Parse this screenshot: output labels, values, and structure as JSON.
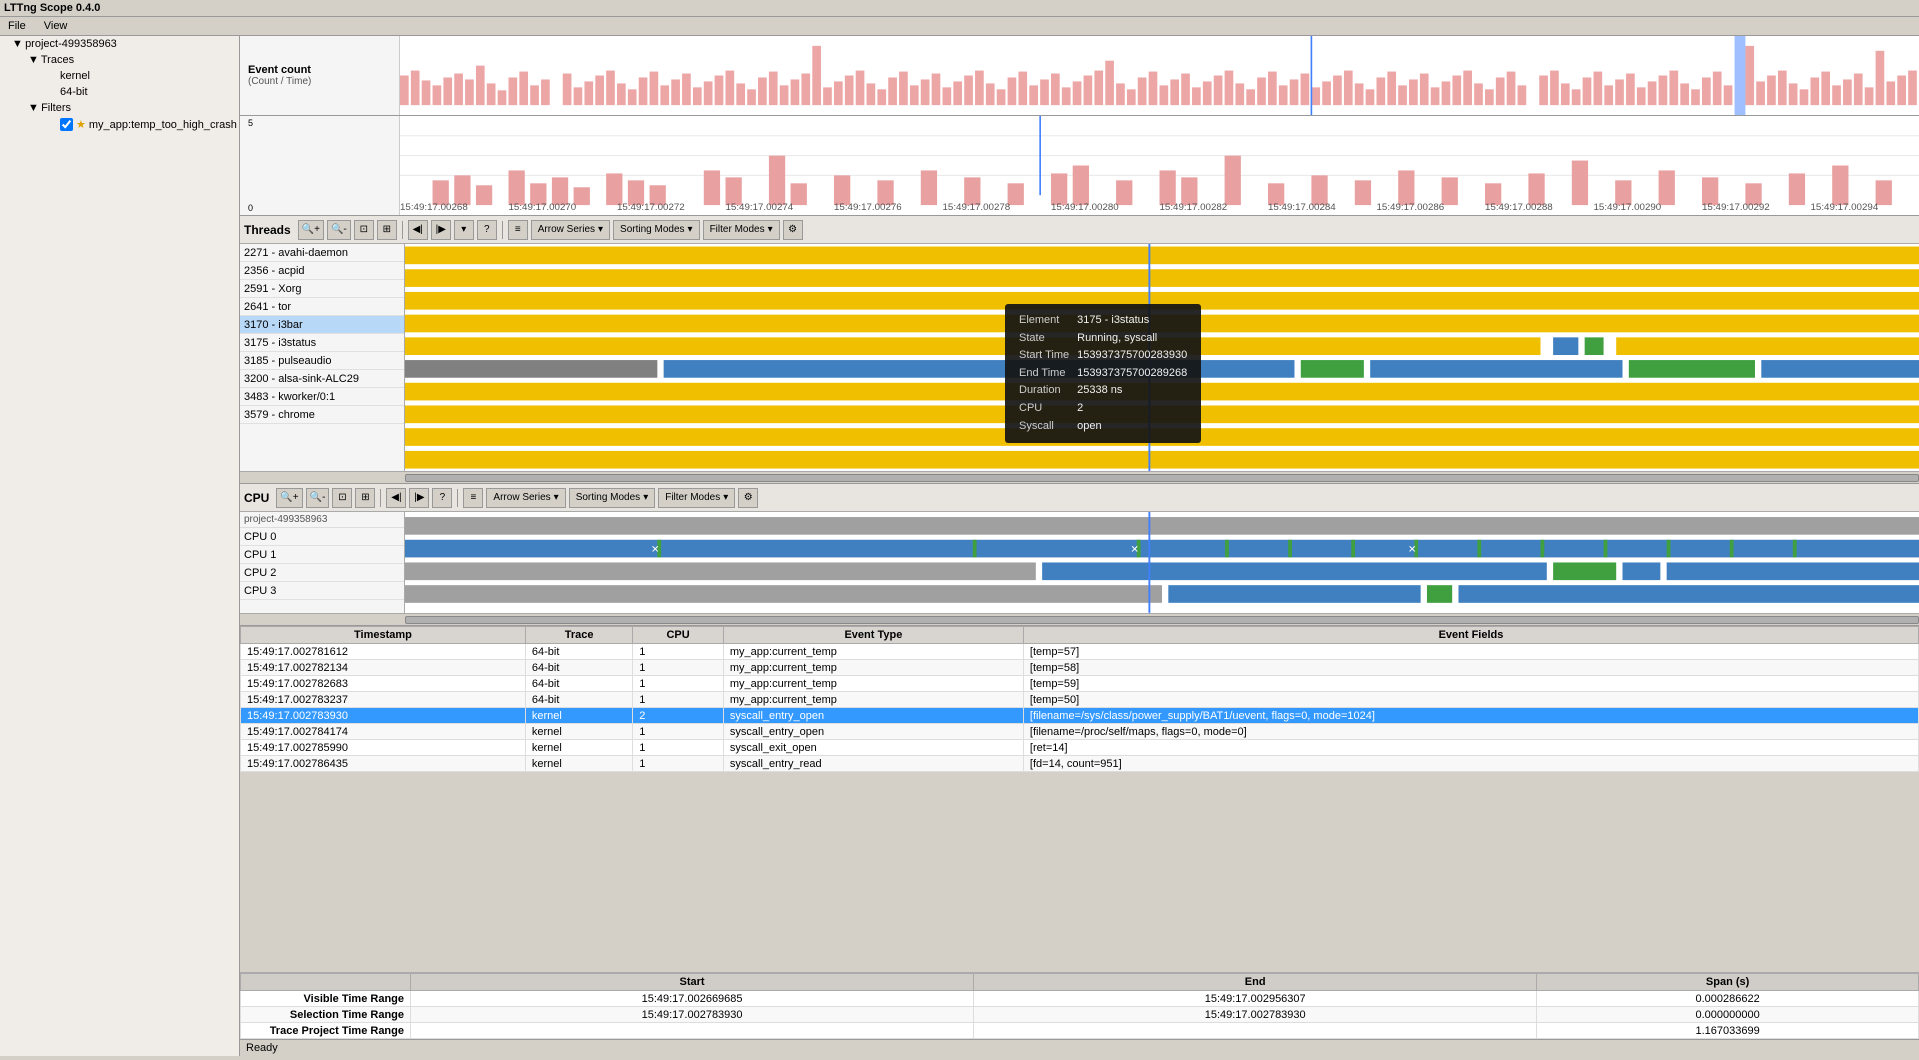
{
  "app": {
    "title": "LTTng Scope 0.4.0",
    "menu": [
      "File",
      "View"
    ],
    "status": "Ready"
  },
  "sidebar": {
    "project": "project-499358963",
    "traces_label": "Traces",
    "traces": [
      "kernel",
      "64-bit"
    ],
    "filters_label": "Filters",
    "filter_item": "my_app:temp_too_high_crash"
  },
  "overview": {
    "event_count_label": "Event count",
    "count_time_label": "(Count / Time)",
    "y_max": "5",
    "y_mid": "",
    "y_zero": "0",
    "timestamps": [
      "15:49:17.00268",
      "15:49:17.00270",
      "15:49:17.00272",
      "15:49:17.00274",
      "15:49:17.00276",
      "15:49:17.00278",
      "15:49:17.00280",
      "15:49:17.00282",
      "15:49:17.00284",
      "15:49:17.00286",
      "15:49:17.00288",
      "15:49:17.00290",
      "15:49:17.00292",
      "15:49:17.00294"
    ]
  },
  "threads": {
    "label": "Threads",
    "toolbar": {
      "zoom_in": "+",
      "zoom_out": "−",
      "zoom_selection": "⊡",
      "reset": "⊞",
      "prev_event": "◀",
      "next_event": "▶",
      "arrow_series": "Arrow Series",
      "sorting_modes": "Sorting Modes",
      "filter_modes": "Filter Modes",
      "settings": "⚙"
    },
    "rows": [
      {
        "id": "2271",
        "name": "avahi-daemon"
      },
      {
        "id": "2356",
        "name": "acpid"
      },
      {
        "id": "2591",
        "name": "Xorg"
      },
      {
        "id": "2641",
        "name": "tor"
      },
      {
        "id": "3170",
        "name": "i3bar",
        "selected": true
      },
      {
        "id": "3175",
        "name": "i3status"
      },
      {
        "id": "3185",
        "name": "pulseaudio"
      },
      {
        "id": "3200",
        "name": "alsa-sink-ALC29"
      },
      {
        "id": "3483",
        "name": "kworker/0:1"
      },
      {
        "id": "3579",
        "name": "chrome"
      }
    ]
  },
  "cpu": {
    "label": "CPU",
    "toolbar": {
      "arrow_series": "Arrow Series",
      "sorting_modes": "Sorting Modes",
      "filter_modes": "Filter Modes"
    },
    "project": "project-499358963",
    "rows": [
      {
        "name": "CPU 0"
      },
      {
        "name": "CPU 1"
      },
      {
        "name": "CPU 2"
      },
      {
        "name": "CPU 3"
      }
    ]
  },
  "tooltip": {
    "element": "3175 - i3status",
    "state": "Running, syscall",
    "start_time": "153937375700283930",
    "end_time": "153937375700289268",
    "duration": "25338 ns",
    "cpu": "2",
    "syscall": "open"
  },
  "events": {
    "columns": [
      "Timestamp",
      "Trace",
      "CPU",
      "Event Type",
      "Event Fields"
    ],
    "rows": [
      {
        "timestamp": "15:49:17.002781612",
        "trace": "64-bit",
        "cpu": "1",
        "type": "my_app:current_temp",
        "fields": "[temp=57]"
      },
      {
        "timestamp": "15:49:17.002782134",
        "trace": "64-bit",
        "cpu": "1",
        "type": "my_app:current_temp",
        "fields": "[temp=58]"
      },
      {
        "timestamp": "15:49:17.002782683",
        "trace": "64-bit",
        "cpu": "1",
        "type": "my_app:current_temp",
        "fields": "[temp=59]"
      },
      {
        "timestamp": "15:49:17.002783237",
        "trace": "64-bit",
        "cpu": "1",
        "type": "my_app:current_temp",
        "fields": "[temp=50]"
      },
      {
        "timestamp": "15:49:17.002783930",
        "trace": "kernel",
        "cpu": "2",
        "type": "syscall_entry_open",
        "fields": "[filename=/sys/class/power_supply/BAT1/uevent, flags=0, mode=1024]",
        "selected": true
      },
      {
        "timestamp": "15:49:17.002784174",
        "trace": "kernel",
        "cpu": "1",
        "type": "syscall_entry_open",
        "fields": "[filename=/proc/self/maps, flags=0, mode=0]"
      },
      {
        "timestamp": "15:49:17.002785990",
        "trace": "kernel",
        "cpu": "1",
        "type": "syscall_exit_open",
        "fields": "[ret=14]"
      },
      {
        "timestamp": "15:49:17.002786435",
        "trace": "kernel",
        "cpu": "1",
        "type": "syscall_entry_read",
        "fields": "[fd=14, count=951]"
      }
    ]
  },
  "time_ranges": {
    "headers": [
      "",
      "Start",
      "End",
      "Span (s)"
    ],
    "visible": {
      "label": "Visible Time Range",
      "start": "15:49:17.002669685",
      "end": "15:49:17.002956307",
      "span": "0.000286622"
    },
    "selection": {
      "label": "Selection Time Range",
      "start": "15:49:17.002783930",
      "end": "15:49:17.002783930",
      "span": "0.000000000"
    },
    "trace_project": {
      "label": "Trace Project Time Range",
      "start": "",
      "end": "",
      "span": "1.167033699"
    }
  }
}
